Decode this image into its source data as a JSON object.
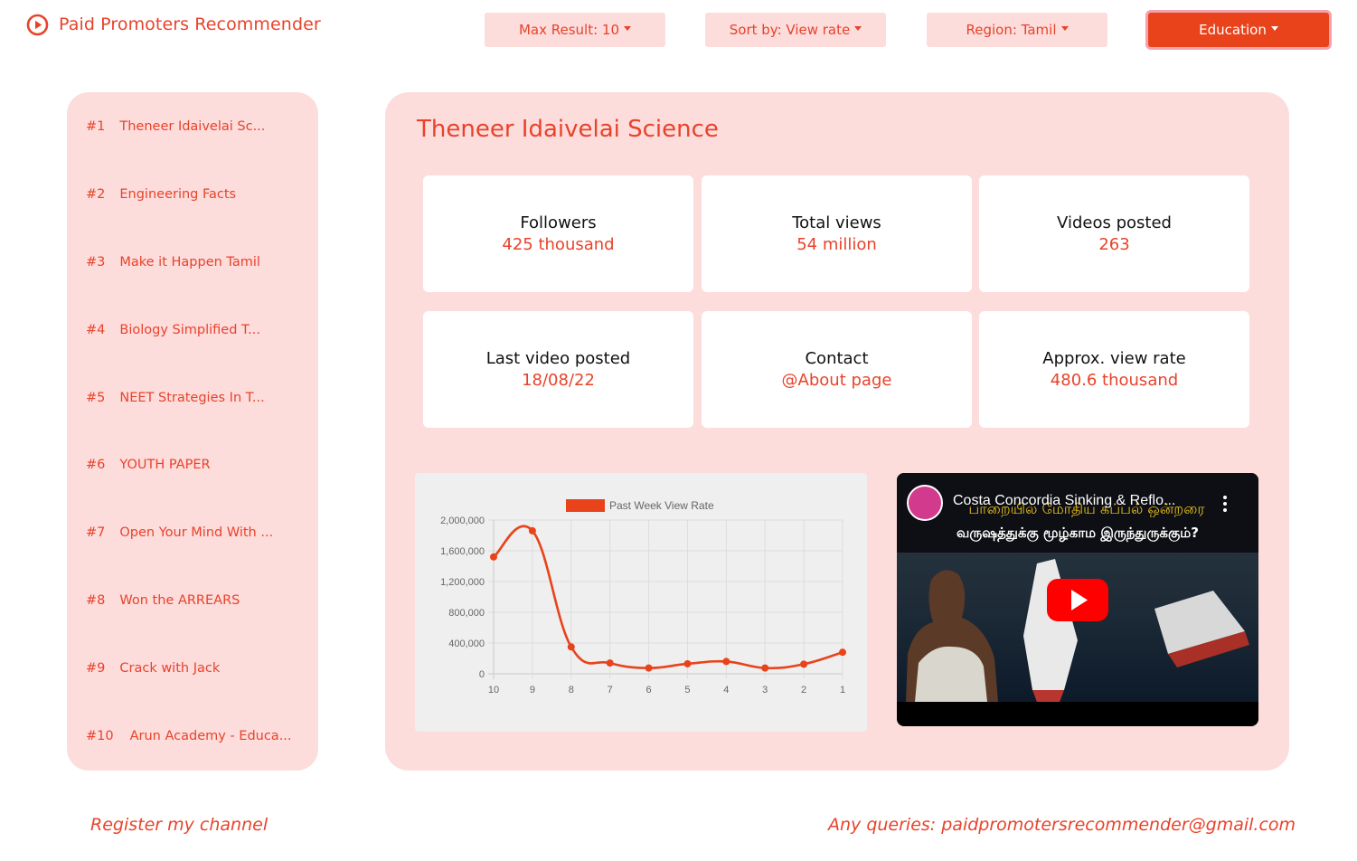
{
  "app": {
    "title": "Paid Promoters Recommender"
  },
  "filters": {
    "max_result": "Max Result: 10",
    "sort_by": "Sort by: View rate",
    "region": "Region: Tamil",
    "category": "Education"
  },
  "sidebar": {
    "items": [
      {
        "rank": "#1",
        "name": "Theneer Idaivelai Sc..."
      },
      {
        "rank": "#2",
        "name": "Engineering Facts"
      },
      {
        "rank": "#3",
        "name": "Make it Happen Tamil"
      },
      {
        "rank": "#4",
        "name": "Biology Simplified T..."
      },
      {
        "rank": "#5",
        "name": "NEET Strategies In T..."
      },
      {
        "rank": "#6",
        "name": "YOUTH PAPER"
      },
      {
        "rank": "#7",
        "name": "Open Your Mind With ..."
      },
      {
        "rank": "#8",
        "name": "Won the ARREARS"
      },
      {
        "rank": "#9",
        "name": "Crack with Jack"
      },
      {
        "rank": "#10",
        "name": "Arun Academy - Educa..."
      }
    ]
  },
  "channel": {
    "name": "Theneer Idaivelai Science",
    "stats": [
      {
        "label": "Followers",
        "value": "425 thousand"
      },
      {
        "label": "Total views",
        "value": "54 million"
      },
      {
        "label": "Videos posted",
        "value": "263"
      },
      {
        "label": "Last video posted",
        "value": "18/08/22"
      },
      {
        "label": "Contact",
        "value": "@About page"
      },
      {
        "label": "Approx. view rate",
        "value": "480.6 thousand"
      }
    ]
  },
  "video": {
    "title": "Costa Concordia Sinking & Reflo...",
    "overlay_line1": "பாறையில் மோதிய கப்பல் ஒன்றரை",
    "overlay_line2": "வருஷத்துக்கு மூழ்காம இருந்துருக்கும்?",
    "icon": "youtube-play-icon"
  },
  "chart_data": {
    "type": "line",
    "categories": [
      "10",
      "9",
      "8",
      "7",
      "6",
      "5",
      "4",
      "3",
      "2",
      "1"
    ],
    "series": [
      {
        "name": "Past Week View Rate",
        "values": [
          1520000,
          1860000,
          350000,
          140000,
          75000,
          130000,
          160000,
          75000,
          125000,
          280000
        ],
        "color": "#e8431b"
      }
    ],
    "yticks": [
      "0",
      "400,000",
      "800,000",
      "1,200,000",
      "1,600,000",
      "2,000,000"
    ],
    "ylim": [
      0,
      2000000
    ],
    "grid": true,
    "legend": "top"
  },
  "footer": {
    "register": "Register my channel",
    "queries": "Any queries: paidpromotersrecommender@gmail.com"
  },
  "colors": {
    "accent": "#e8432a",
    "active_button": "#e9431b",
    "panel_bg": "#fddcdc"
  }
}
